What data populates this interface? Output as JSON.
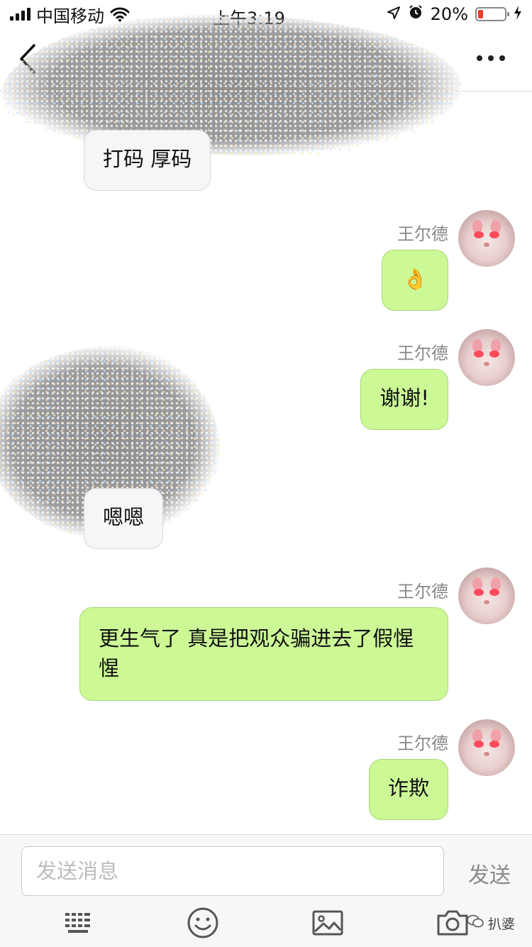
{
  "status_bar": {
    "carrier": "中国移动",
    "time": "上午3:19",
    "battery": "20%",
    "battery_level": 0.2
  },
  "nav": {
    "back_icon": "chevron-left-icon",
    "more_icon": "more-horizontal-icon"
  },
  "messages": [
    {
      "side": "other",
      "text": "打码 厚码"
    },
    {
      "side": "me",
      "sender": "王尔德",
      "text": "👌"
    },
    {
      "side": "me",
      "sender": "王尔德",
      "text": "谢谢!"
    },
    {
      "side": "other",
      "text": "嗯嗯"
    },
    {
      "side": "me",
      "sender": "王尔德",
      "text": "更生气了 真是把观众骗进去了假惺惺"
    },
    {
      "side": "me",
      "sender": "王尔德",
      "text": "诈欺"
    }
  ],
  "composer": {
    "placeholder": "发送消息",
    "send_label": "发送",
    "tools": [
      "keyboard-icon",
      "emoji-icon",
      "image-icon",
      "camera-icon"
    ]
  },
  "watermark": "扒婆",
  "colors": {
    "my_bubble": "#ccf996",
    "other_bubble": "#f6f5f8",
    "battery_low": "#f03a2e"
  }
}
